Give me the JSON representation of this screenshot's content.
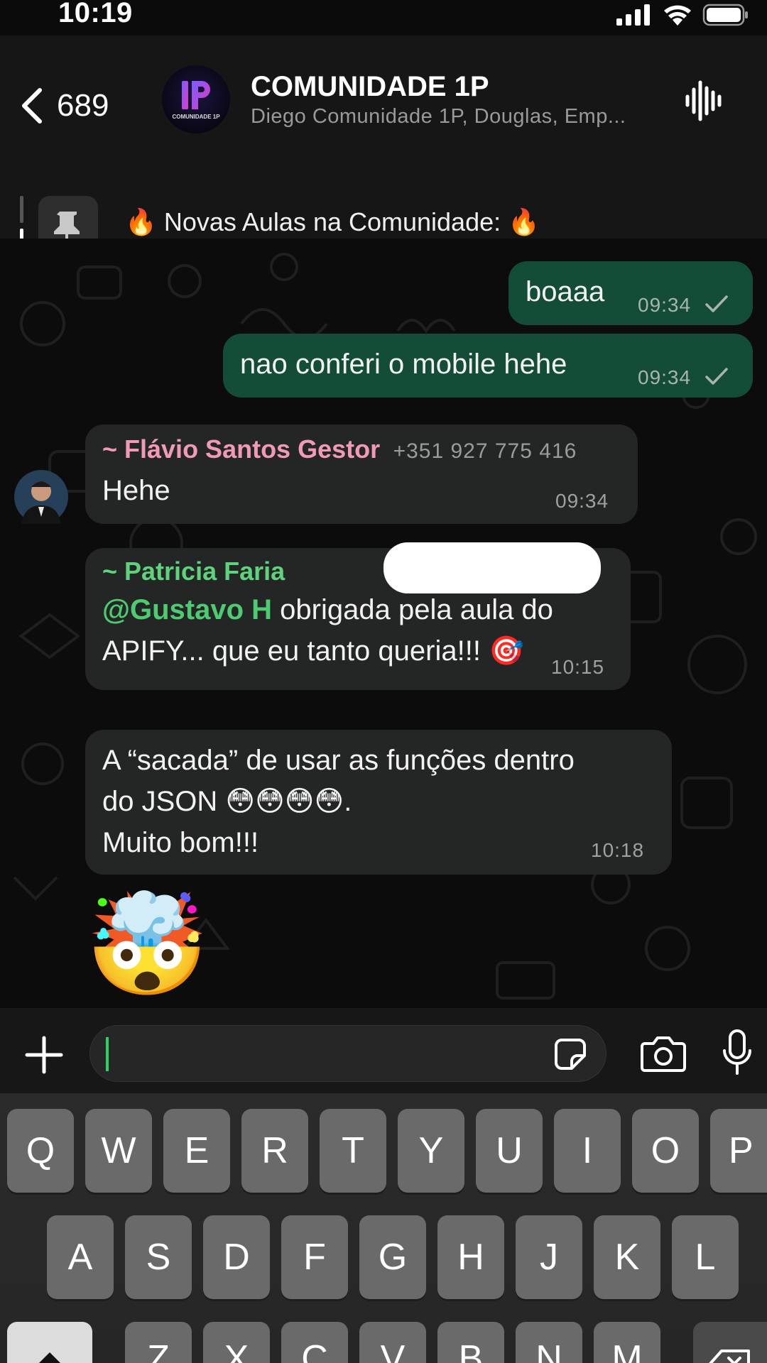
{
  "status_bar": {
    "time": "10:19"
  },
  "header": {
    "back_count": "689",
    "title": "COMUNIDADE 1P",
    "subtitle": "Diego Comunidade 1P, Douglas, Emp...",
    "avatar_text": "COMUNIDADE 1P"
  },
  "pinned": {
    "text": "🔥 Novas Aulas na Comunidade: 🔥"
  },
  "messages": [
    {
      "direction": "out",
      "text": "boaaa",
      "time": "09:34"
    },
    {
      "direction": "out",
      "text": "nao conferi o mobile hehe",
      "time": "09:34"
    },
    {
      "direction": "in",
      "sender": "~ Flávio Santos Gestor",
      "phone": "+351 927 775 416",
      "text": "Hehe",
      "time": "09:34"
    },
    {
      "direction": "in",
      "sender": "~ Patricia Faria",
      "mention": "@Gustavo H",
      "text_line1": " obrigada pela aula do",
      "text_line2": "APIFY... que eu tanto queria!!! 🎯",
      "time": "10:15"
    },
    {
      "direction": "in",
      "text_line1": "A “sacada” de usar as funções dentro",
      "text_line2": "do JSON 😳😳😳😳.",
      "text_line3": "Muito bom!!!",
      "time": "10:18"
    },
    {
      "direction": "in",
      "emoji": "🤯"
    }
  ],
  "colors": {
    "accent_green": "#25d366",
    "outgoing_bubble": "#144d37",
    "incoming_bubble": "#242626",
    "sender_flavio": "#f19ab7",
    "sender_patricia": "#5fd27c",
    "mention": "#4ecb71"
  },
  "keyboard": {
    "row1": [
      "Q",
      "W",
      "E",
      "R",
      "T",
      "Y",
      "U",
      "I",
      "O",
      "P"
    ],
    "row2": [
      "A",
      "S",
      "D",
      "F",
      "G",
      "H",
      "J",
      "K",
      "L"
    ],
    "row3": [
      "Z",
      "X",
      "C",
      "V",
      "B",
      "N",
      "M"
    ]
  },
  "icons": [
    "back-chevron-icon",
    "waveform-icon",
    "pin-icon",
    "plus-icon",
    "sticker-icon",
    "camera-icon",
    "microphone-icon",
    "shift-icon",
    "backspace-icon",
    "signal-icon",
    "wifi-icon",
    "battery-icon",
    "single-check-icon"
  ]
}
